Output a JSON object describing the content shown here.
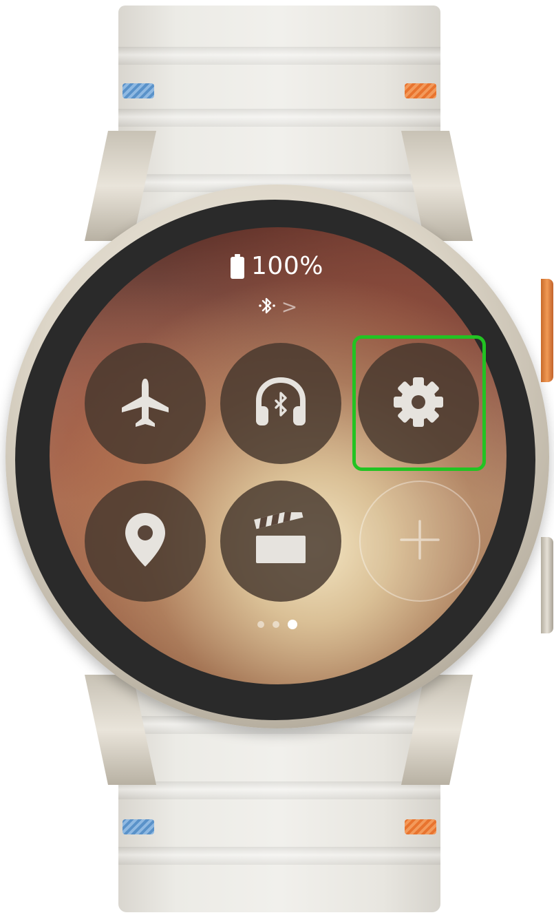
{
  "status": {
    "battery_text": "100%",
    "battery_icon": "battery-full-icon",
    "bluetooth_icon": "bluetooth-icon",
    "bluetooth_chevron": ">"
  },
  "tiles": [
    {
      "name": "airplane-mode",
      "icon": "airplane-icon",
      "active": false
    },
    {
      "name": "bluetooth-audio",
      "icon": "bluetooth-headphones-icon",
      "active": false
    },
    {
      "name": "settings",
      "icon": "gear-icon",
      "active": false,
      "highlighted": true
    },
    {
      "name": "location",
      "icon": "location-pin-icon",
      "active": false
    },
    {
      "name": "theater-mode",
      "icon": "clapperboard-icon",
      "active": false
    },
    {
      "name": "add-tile",
      "icon": "plus-icon",
      "active": false
    }
  ],
  "pagination": {
    "count": 3,
    "current": 3
  },
  "colors": {
    "highlight": "#22c322",
    "tile_icon": "#e6e3de",
    "crown_accent": "#f09a55"
  }
}
